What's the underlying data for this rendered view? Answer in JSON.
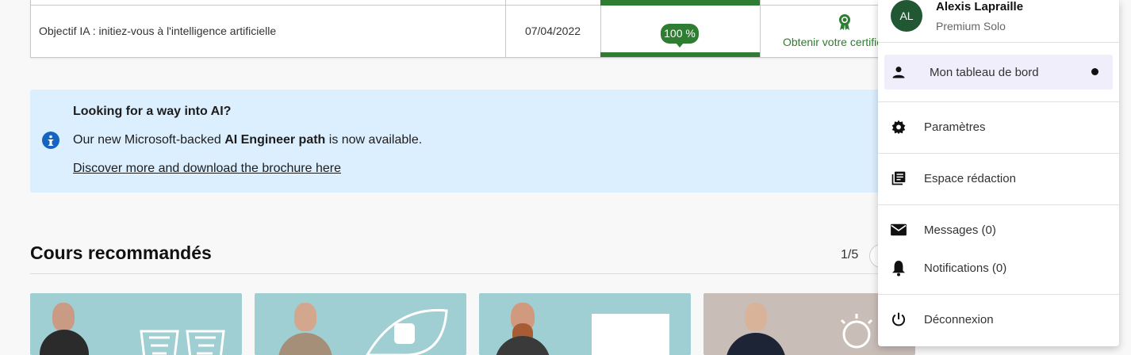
{
  "course_table": {
    "course_title": "Objectif IA : initiez-vous à l'intelligence artificielle",
    "date": "07/04/2022",
    "progress_label": "100 %",
    "progress": 1.0,
    "certificate_link": "Obtenir votre certificat",
    "accent_color": "#2e7d32"
  },
  "banner": {
    "icon": "info-icon",
    "title": "Looking for a way into AI?",
    "text_before": "Our new Microsoft-backed ",
    "text_bold": "AI Engineer path",
    "text_after": " is now available.",
    "link": "Discover more and download the brochure here",
    "background_color": "#dcefff"
  },
  "recommended": {
    "title": "Cours recommandés",
    "pager": "1/5"
  },
  "user_menu": {
    "avatar_initials": "AL",
    "name": "Alexis Lapraille",
    "plan": "Premium Solo",
    "items": [
      {
        "label": "Mon tableau de bord",
        "icon": "person-icon",
        "active": true
      },
      {
        "label": "Paramètres",
        "icon": "gear-icon"
      },
      {
        "label": "Espace rédaction",
        "icon": "library-icon"
      },
      {
        "label": "Messages (0)",
        "icon": "mail-icon"
      },
      {
        "label": "Notifications (0)",
        "icon": "bell-icon"
      },
      {
        "label": "Déconnexion",
        "icon": "power-icon"
      }
    ]
  }
}
